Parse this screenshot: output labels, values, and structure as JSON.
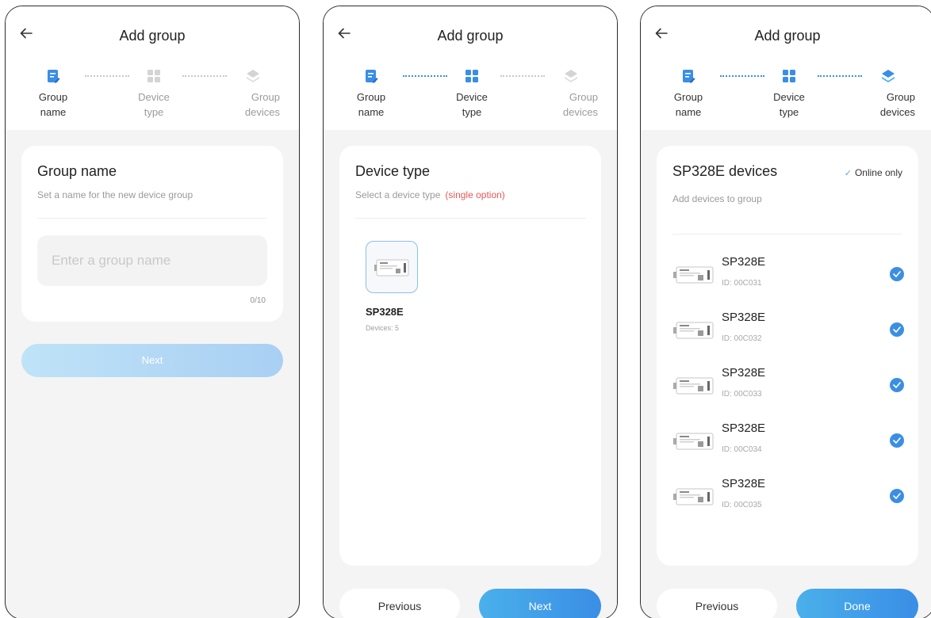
{
  "header": {
    "title": "Add group"
  },
  "steps": [
    "Group\nname",
    "Device\ntype",
    "Group\ndevices"
  ],
  "screen1": {
    "card_title": "Group name",
    "card_subtitle": "Set a name for the new device group",
    "input_placeholder": "Enter a group name",
    "input_value": "",
    "counter": "0/10",
    "next_label": "Next"
  },
  "screen2": {
    "card_title": "Device type",
    "card_subtitle": "Select a device type",
    "card_subtitle_note": "(single option)",
    "device_type": {
      "name": "SP328E",
      "count": "Devices: 5"
    },
    "previous_label": "Previous",
    "next_label": "Next"
  },
  "screen3": {
    "card_title": "SP328E devices",
    "card_subtitle": "Add devices to group",
    "online_only_label": "Online only",
    "devices": [
      {
        "name": "SP328E",
        "id": "ID: 00C031",
        "checked": true
      },
      {
        "name": "SP328E",
        "id": "ID: 00C032",
        "checked": true
      },
      {
        "name": "SP328E",
        "id": "ID: 00C033",
        "checked": true
      },
      {
        "name": "SP328E",
        "id": "ID: 00C034",
        "checked": true
      },
      {
        "name": "SP328E",
        "id": "ID: 00C035",
        "checked": true
      }
    ],
    "previous_label": "Previous",
    "done_label": "Done"
  },
  "colors": {
    "accent": "#3a8ee6",
    "accent_light": "#4ab0ea",
    "note_red": "#e85757",
    "disabled_button": "#bfe3f7",
    "inactive_step": "#c8c8c8"
  },
  "icons": {
    "back": "arrow-left-icon",
    "step_group_name": "edit-document-icon",
    "step_device_type": "grid-icon",
    "step_group_devices": "stack-icon",
    "check": "checkmark-icon",
    "device": "controller-device-icon"
  }
}
